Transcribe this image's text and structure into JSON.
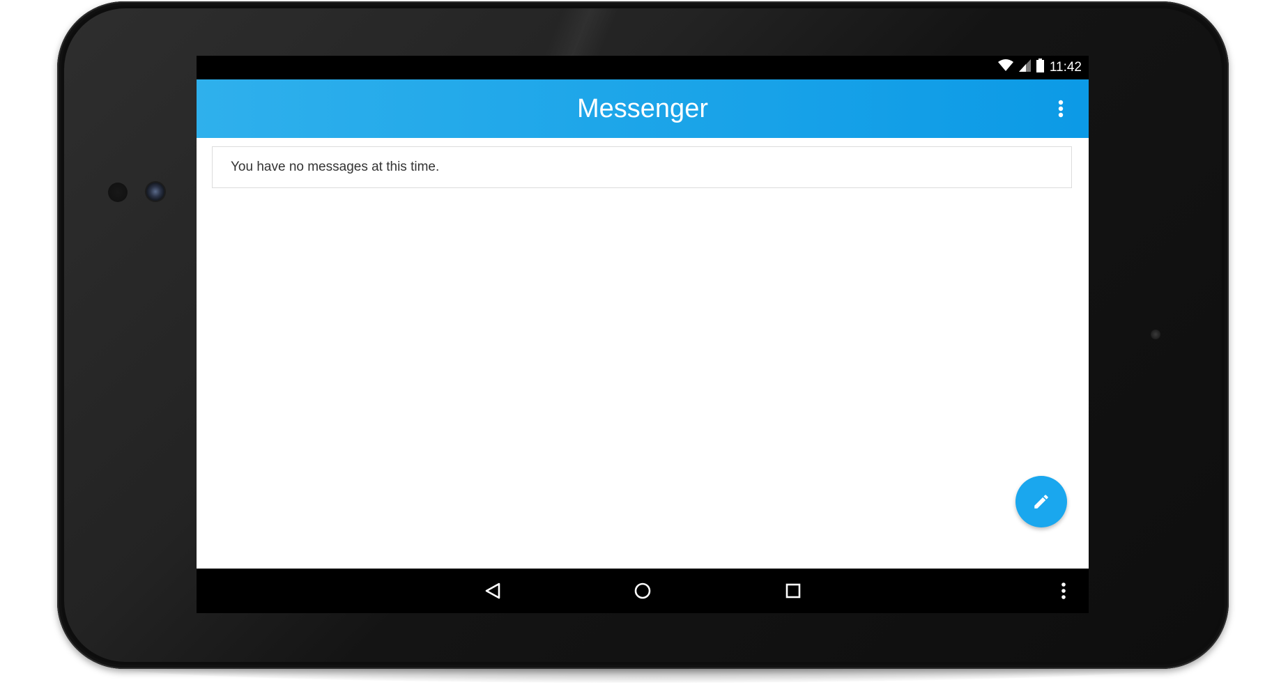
{
  "status_bar": {
    "time": "11:42",
    "icons": [
      "wifi-icon",
      "signal-icon",
      "battery-icon"
    ]
  },
  "app_bar": {
    "title": "Messenger",
    "overflow_icon": "more-vertical-icon",
    "color": "#1EA6E9"
  },
  "message_list": {
    "empty_text": "You have no messages at this time."
  },
  "fab": {
    "icon": "pencil-icon",
    "color": "#1AA7EE"
  },
  "navigation_bar": {
    "buttons": [
      "back-icon",
      "home-icon",
      "recents-icon",
      "menu-icon"
    ]
  }
}
